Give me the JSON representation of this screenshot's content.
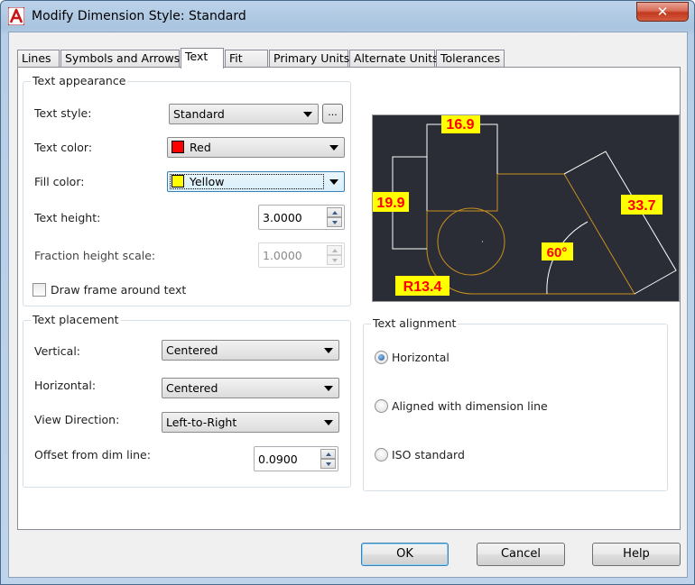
{
  "window": {
    "title": "Modify Dimension Style: Standard",
    "close_glyph": "✕"
  },
  "tabs": [
    {
      "label": "Lines",
      "active": false
    },
    {
      "label": "Symbols and Arrows",
      "active": false
    },
    {
      "label": "Text",
      "active": true
    },
    {
      "label": "Fit",
      "active": false
    },
    {
      "label": "Primary Units",
      "active": false
    },
    {
      "label": "Alternate Units",
      "active": false
    },
    {
      "label": "Tolerances",
      "active": false
    }
  ],
  "text_appearance": {
    "title": "Text appearance",
    "text_style_label": "Text style:",
    "text_style_value": "Standard",
    "browse_label": "...",
    "text_color_label": "Text color:",
    "text_color_value": "Red",
    "text_color_swatch": "#ff0000",
    "fill_color_label": "Fill color:",
    "fill_color_value": "Yellow",
    "fill_color_swatch": "#ffff00",
    "text_height_label": "Text height:",
    "text_height_value": "3.0000",
    "fraction_label": "Fraction height scale:",
    "fraction_value": "1.0000",
    "draw_frame_label": "Draw frame around text",
    "draw_frame_checked": false
  },
  "text_placement": {
    "title": "Text placement",
    "vertical_label": "Vertical:",
    "vertical_value": "Centered",
    "horizontal_label": "Horizontal:",
    "horizontal_value": "Centered",
    "view_direction_label": "View Direction:",
    "view_direction_value": "Left-to-Right",
    "offset_label": "Offset from dim line:",
    "offset_value": "0.0900"
  },
  "text_alignment": {
    "title": "Text alignment",
    "options": [
      {
        "label": "Horizontal",
        "checked": true
      },
      {
        "label": "Aligned with dimension line",
        "checked": false
      },
      {
        "label": "ISO standard",
        "checked": false
      }
    ]
  },
  "preview": {
    "labels": [
      "16.9",
      "19.9",
      "33.7",
      "60°",
      "R13.4"
    ],
    "background": "#2b2d36",
    "text_color": "#ff0000",
    "fill_color": "#ffff00",
    "geometry_color": "#c8901e",
    "dimline_color": "#ffffff"
  },
  "buttons": {
    "ok": "OK",
    "cancel": "Cancel",
    "help": "Help"
  }
}
